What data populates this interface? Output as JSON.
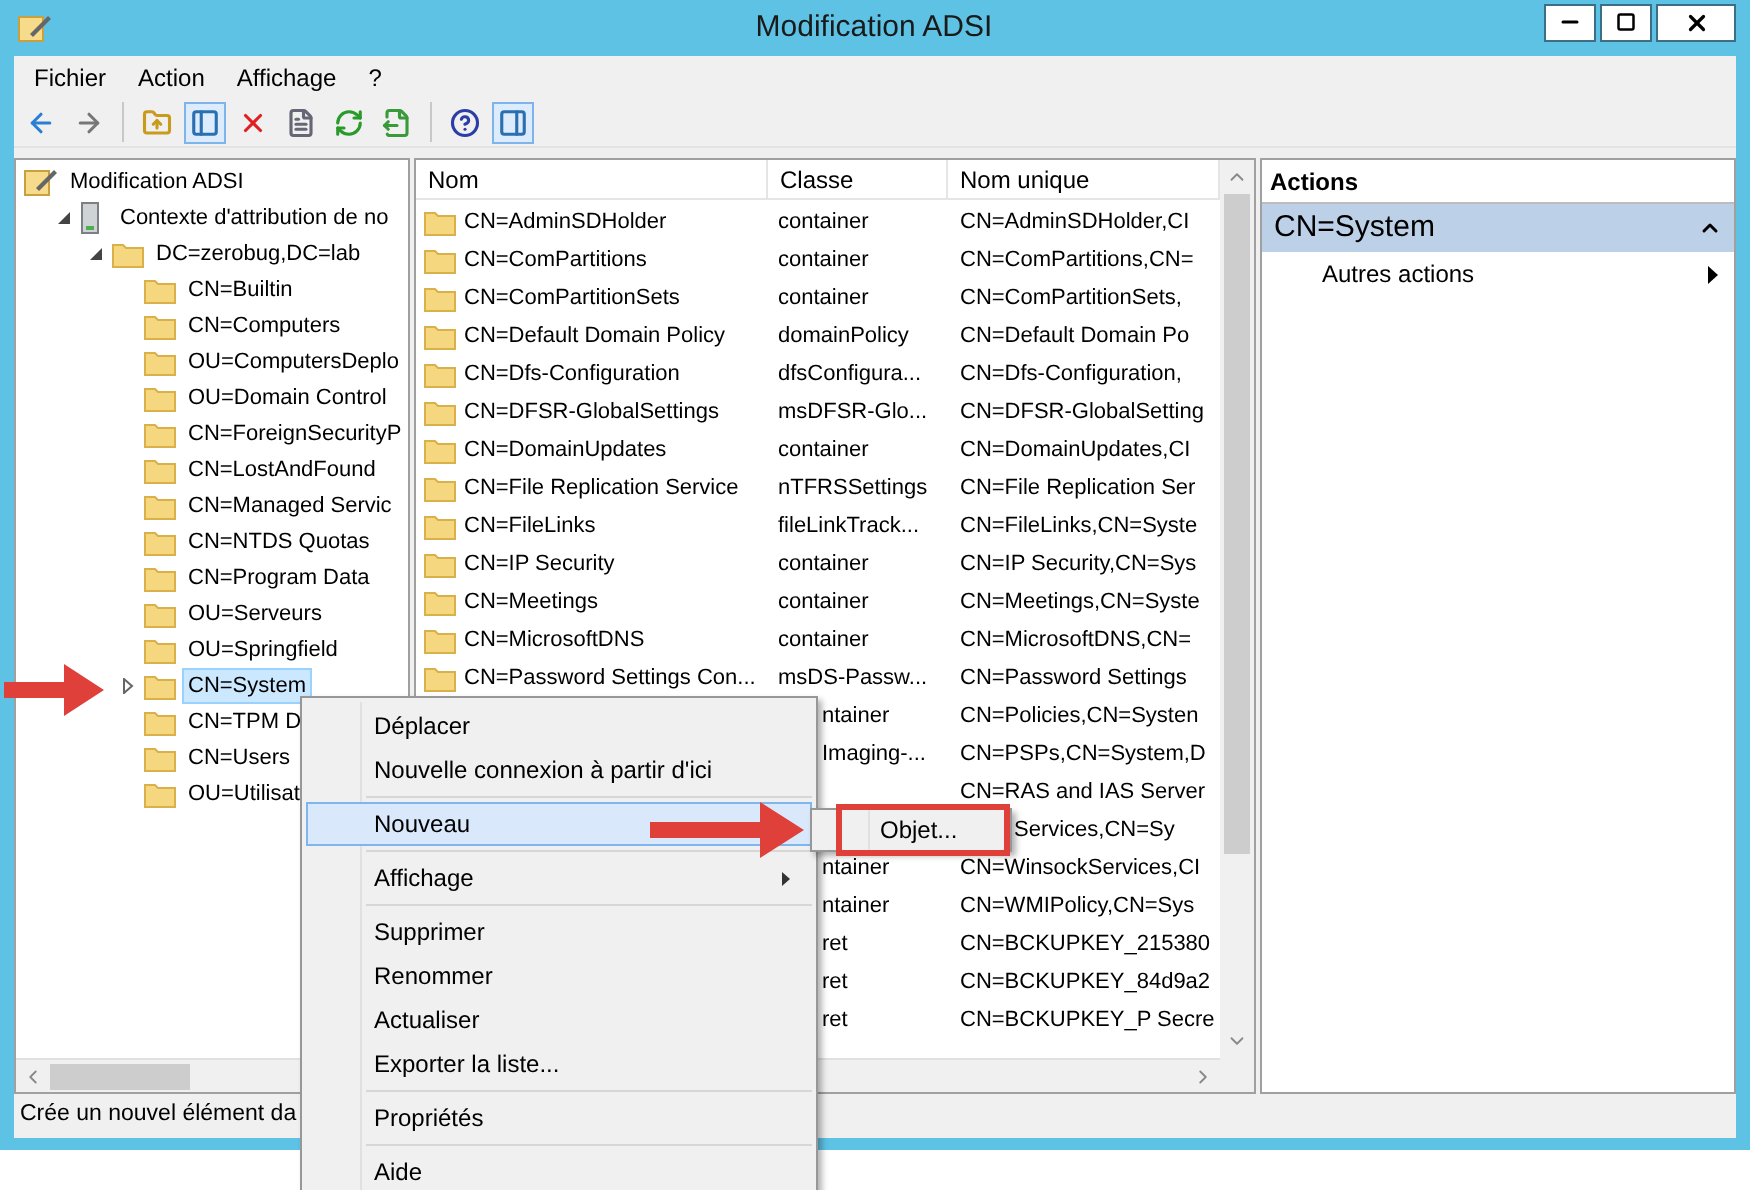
{
  "window": {
    "title": "Modification ADSI"
  },
  "menu": [
    "Fichier",
    "Action",
    "Affichage",
    "?"
  ],
  "toolbar": [
    {
      "kind": "back",
      "selected": false
    },
    {
      "kind": "forward",
      "selected": false
    },
    {
      "kind": "separator"
    },
    {
      "kind": "up",
      "selected": false
    },
    {
      "kind": "tree-pane",
      "selected": true
    },
    {
      "kind": "delete",
      "selected": false
    },
    {
      "kind": "properties",
      "selected": false
    },
    {
      "kind": "refresh",
      "selected": false
    },
    {
      "kind": "export",
      "selected": false
    },
    {
      "kind": "separator"
    },
    {
      "kind": "help",
      "selected": false
    },
    {
      "kind": "action-pane",
      "selected": true
    }
  ],
  "tree": {
    "label": "Modification ADSI",
    "children": [
      {
        "label": "Contexte d'attribution de no",
        "expanded": true,
        "children": [
          {
            "label": "DC=zerobug,DC=lab",
            "expanded": true,
            "children": [
              {
                "label": "CN=Builtin",
                "selected": false
              },
              {
                "label": "CN=Computers",
                "selected": false
              },
              {
                "label": "OU=ComputersDeplo",
                "selected": false
              },
              {
                "label": "OU=Domain Control",
                "selected": false
              },
              {
                "label": "CN=ForeignSecurityP",
                "selected": false
              },
              {
                "label": "CN=LostAndFound",
                "selected": false
              },
              {
                "label": "CN=Managed Servic",
                "selected": false
              },
              {
                "label": "CN=NTDS Quotas",
                "selected": false
              },
              {
                "label": "CN=Program Data",
                "selected": false
              },
              {
                "label": "OU=Serveurs",
                "selected": false
              },
              {
                "label": "OU=Springfield",
                "selected": false
              },
              {
                "label": "CN=System",
                "selected": true,
                "expanded": false
              },
              {
                "label": "CN=TPM D",
                "selected": false
              },
              {
                "label": "CN=Users",
                "selected": false
              },
              {
                "label": "OU=Utilisat",
                "selected": false
              }
            ]
          }
        ]
      }
    ]
  },
  "list": {
    "columns": [
      "Nom",
      "Classe",
      "Nom unique"
    ],
    "rows": [
      {
        "name": "CN=AdminSDHolder",
        "class": "container",
        "dn": "CN=AdminSDHolder,CI"
      },
      {
        "name": "CN=ComPartitions",
        "class": "container",
        "dn": "CN=ComPartitions,CN="
      },
      {
        "name": "CN=ComPartitionSets",
        "class": "container",
        "dn": "CN=ComPartitionSets,"
      },
      {
        "name": "CN=Default Domain Policy",
        "class": "domainPolicy",
        "dn": "CN=Default Domain Po"
      },
      {
        "name": "CN=Dfs-Configuration",
        "class": "dfsConfigura...",
        "dn": "CN=Dfs-Configuration,"
      },
      {
        "name": "CN=DFSR-GlobalSettings",
        "class": "msDFSR-Glo...",
        "dn": "CN=DFSR-GlobalSetting"
      },
      {
        "name": "CN=DomainUpdates",
        "class": "container",
        "dn": "CN=DomainUpdates,CI"
      },
      {
        "name": "CN=File Replication Service",
        "class": "nTFRSSettings",
        "dn": "CN=File Replication Ser"
      },
      {
        "name": "CN=FileLinks",
        "class": "fileLinkTrack...",
        "dn": "CN=FileLinks,CN=Syste"
      },
      {
        "name": "CN=IP Security",
        "class": "container",
        "dn": "CN=IP Security,CN=Sys"
      },
      {
        "name": "CN=Meetings",
        "class": "container",
        "dn": "CN=Meetings,CN=Syste"
      },
      {
        "name": "CN=MicrosoftDNS",
        "class": "container",
        "dn": "CN=MicrosoftDNS,CN="
      },
      {
        "name": "CN=Password Settings Con...",
        "class": "msDS-Passw...",
        "dn": "CN=Password Settings"
      },
      {
        "kind": "menu",
        "class": "ntainer",
        "dn": "CN=Policies,CN=Systen"
      },
      {
        "kind": "menu",
        "class": "Imaging-...",
        "dn": "CN=PSPs,CN=System,D"
      },
      {
        "kind": "menu",
        "dn": "CN=RAS and IAS Server"
      },
      {
        "kind": "submenu",
        "dn": "Services,CN=Sy"
      },
      {
        "kind": "menu",
        "class": "ntainer",
        "dn": "CN=WinsockServices,CI"
      },
      {
        "kind": "menu",
        "class": "ntainer",
        "dn": "CN=WMIPolicy,CN=Sys"
      },
      {
        "kind": "menu",
        "class": "ret",
        "dn": "CN=BCKUPKEY_215380"
      },
      {
        "kind": "menu",
        "class": "ret",
        "dn": "CN=BCKUPKEY_84d9a2"
      },
      {
        "kind": "menu",
        "class": "ret",
        "dn": "CN=BCKUPKEY_P Secre"
      }
    ]
  },
  "actions": {
    "header": "Actions",
    "section": "CN=System",
    "expanded": true,
    "items": [
      "Autres actions"
    ]
  },
  "context_menu": [
    {
      "kind": "item",
      "label": "Déplacer",
      "submenu": false,
      "selected": false
    },
    {
      "kind": "item",
      "label": "Nouvelle connexion à partir d'ici",
      "submenu": false,
      "selected": false
    },
    {
      "kind": "separator"
    },
    {
      "kind": "item",
      "label": "Nouveau",
      "submenu": true,
      "selected": true
    },
    {
      "kind": "separator"
    },
    {
      "kind": "item",
      "label": "Affichage",
      "submenu": true,
      "selected": false
    },
    {
      "kind": "separator"
    },
    {
      "kind": "item",
      "label": "Supprimer",
      "submenu": false,
      "selected": false
    },
    {
      "kind": "item",
      "label": "Renommer",
      "submenu": false,
      "selected": false
    },
    {
      "kind": "item",
      "label": "Actualiser",
      "submenu": false,
      "selected": false
    },
    {
      "kind": "item",
      "label": "Exporter la liste...",
      "submenu": false,
      "selected": false
    },
    {
      "kind": "separator"
    },
    {
      "kind": "item",
      "label": "Propriétés",
      "submenu": false,
      "selected": false
    },
    {
      "kind": "separator"
    },
    {
      "kind": "item",
      "label": "Aide",
      "submenu": false,
      "selected": false
    }
  ],
  "submenu": [
    "Objet..."
  ],
  "status_bar": "Crée un nouvel élément da"
}
